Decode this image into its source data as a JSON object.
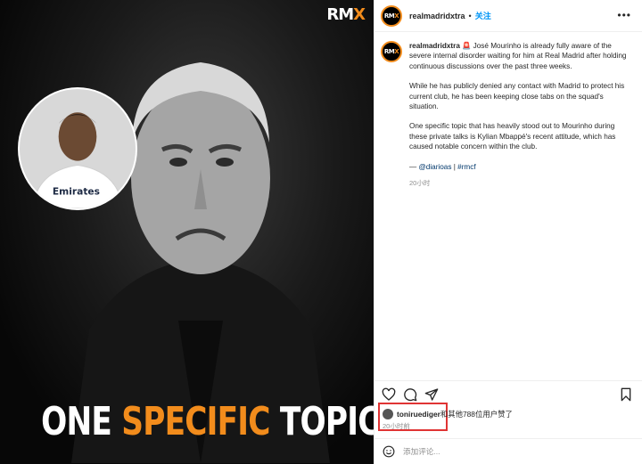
{
  "media": {
    "brand_logo": "RMX",
    "headline": {
      "part1": "ONE ",
      "highlight": "SPECIFIC",
      "part2": " TOPIC."
    },
    "colors": {
      "accent": "#f28c1c",
      "background": "#0b0b0b"
    }
  },
  "header": {
    "username": "realmadridxtra",
    "separator": "•",
    "follow_label": "关注",
    "more_icon": "more-horizontal-icon"
  },
  "caption": {
    "username": "realmadridxtra",
    "flag_emoji": "🚨",
    "paragraph1": "José Mourinho is already fully aware of the severe internal disorder waiting for him at Real Madrid after holding continuous discussions over the past three weeks.",
    "paragraph2": "While he has publicly denied any contact with Madrid to protect his current club, he has been keeping close tabs on the squad's situation.",
    "paragraph3": "One specific topic that has heavily stood out to Mourinho during these private talks is Kylian Mbappé's recent attitude, which has caused notable concern within the club.",
    "source_prefix": "— ",
    "source_handle": "@diarioas",
    "source_sep": " | ",
    "source_tag": "#rmcf",
    "time": "20小时"
  },
  "actions": {
    "like_icon": "heart-icon",
    "comment_icon": "comment-icon",
    "share_icon": "send-icon",
    "save_icon": "bookmark-icon"
  },
  "likes": {
    "user": "toniruediger",
    "text": "和其他788位用户赞了",
    "time": "20小时前"
  },
  "comment": {
    "placeholder": "添加评论...",
    "emoji_icon": "emoji-icon"
  }
}
